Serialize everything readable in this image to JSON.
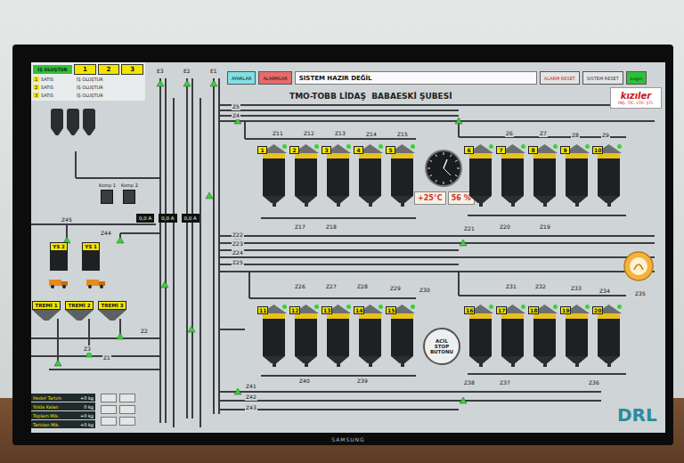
{
  "job_table": {
    "header": "İŞ OLUŞTUR",
    "columns": [
      "1",
      "2",
      "3"
    ],
    "rows": [
      {
        "no": "1",
        "type": "SATIS",
        "action": "İŞ OLUŞTUR"
      },
      {
        "no": "2",
        "type": "SATIS",
        "action": "İŞ OLUŞTUR"
      },
      {
        "no": "3",
        "type": "SATIS",
        "action": "İŞ OLUŞTUR"
      }
    ]
  },
  "toolbar": {
    "settings": "AYARLAR",
    "alarms": "ALARMLAR",
    "status": "SISTEM HAZIR DEĞİL",
    "alarm_reset": "ALARM RESET",
    "system_reset": "SISTEM RESET",
    "login": "Login"
  },
  "title": "TMO-TOBB LİDAŞ  BABAESKİ ŞUBESİ",
  "company_logo": {
    "name": "kızıler",
    "subtitle": "İNŞ. TİC. LTD. ŞTİ."
  },
  "elevators": [
    "E3",
    "E2",
    "E1"
  ],
  "silos": {
    "top": [
      {
        "number": "1"
      },
      {
        "number": "2"
      },
      {
        "number": "3"
      },
      {
        "number": "4"
      },
      {
        "number": "5"
      },
      {
        "number": "6"
      },
      {
        "number": "7"
      },
      {
        "number": "8"
      },
      {
        "number": "9"
      },
      {
        "number": "10"
      }
    ],
    "bottom": [
      {
        "number": "11"
      },
      {
        "number": "12"
      },
      {
        "number": "13"
      },
      {
        "number": "14"
      },
      {
        "number": "15"
      },
      {
        "number": "16"
      },
      {
        "number": "17"
      },
      {
        "number": "18"
      },
      {
        "number": "19"
      },
      {
        "number": "20"
      }
    ]
  },
  "weather": {
    "temperature": "+25°C",
    "humidity": "56 %"
  },
  "current_meters": [
    "0,0 A",
    "0,0 A",
    "0,0 A"
  ],
  "compressors": [
    "Komp 1",
    "Komp 2"
  ],
  "weighers": [
    "YS 2",
    "YS 1"
  ],
  "hoppers": [
    "TREMİ 1",
    "TREMİ 2",
    "TREMİ 3"
  ],
  "emergency_stop": "ACİL STOP BUTONU",
  "conveyors": [
    "Z1",
    "Z2",
    "Z3",
    "Z4",
    "Z5",
    "Z6",
    "Z7",
    "Z8",
    "Z9",
    "Z11",
    "Z12",
    "Z13",
    "Z14",
    "Z15",
    "Z17",
    "Z18",
    "Z19",
    "Z20",
    "Z21",
    "Z22",
    "Z23",
    "Z24",
    "Z25",
    "Z26",
    "Z27",
    "Z28",
    "Z29",
    "Z30",
    "Z31",
    "Z32",
    "Z33",
    "Z34",
    "Z35",
    "Z36",
    "Z37",
    "Z38",
    "Z39",
    "Z40",
    "Z41",
    "Z42",
    "Z43",
    "Z44",
    "Z45"
  ],
  "weighing": [
    {
      "label": "Hedef Tartım",
      "value": "+0 kg"
    },
    {
      "label": "Yolda Kalan",
      "value": "0 kg"
    },
    {
      "label": "Toplam Mik.",
      "value": "+0 kg"
    },
    {
      "label": "Tartılan Mik.",
      "value": "+0 kg"
    }
  ],
  "brand": "DRL",
  "monitor_brand": "SAMSUNG"
}
